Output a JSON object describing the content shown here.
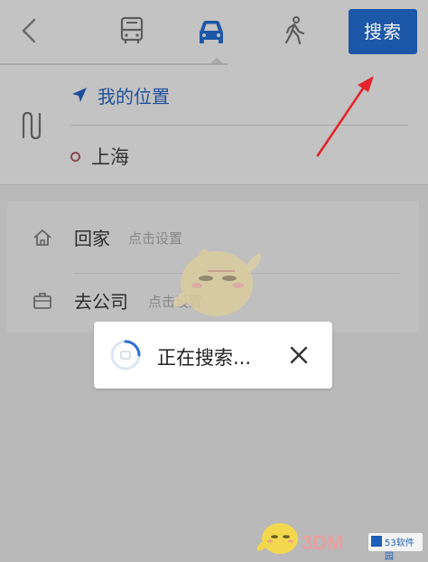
{
  "header": {
    "back_icon": "chevron-left-icon",
    "modes": [
      {
        "icon": "bus-icon"
      },
      {
        "icon": "car-icon",
        "active": true
      },
      {
        "icon": "walk-icon"
      }
    ],
    "search_label": "搜索",
    "accent_color": "#1d57a7"
  },
  "route": {
    "origin": "我的位置",
    "destination": "上海"
  },
  "favorites": {
    "home": {
      "label": "回家",
      "hint": "点击设置"
    },
    "work": {
      "label": "去公司",
      "hint": "点击设置"
    }
  },
  "toast": {
    "text": "正在搜索...",
    "close_icon": "close-icon"
  },
  "watermark": {
    "brand": "3DM",
    "site": "53软件园"
  }
}
